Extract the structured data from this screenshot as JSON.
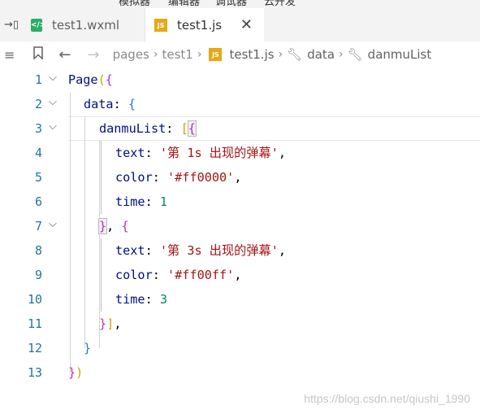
{
  "menubar": {
    "items": [
      "模拟器",
      "编辑器",
      "调试器",
      "云开发"
    ]
  },
  "tabs": [
    {
      "label": "test1.wxml",
      "icon": "wxml-file-icon",
      "active": false
    },
    {
      "label": "test1.js",
      "icon": "js-file-icon",
      "active": true
    }
  ],
  "breadcrumb": {
    "items": [
      "pages",
      "test1",
      "test1.js",
      "data",
      "danmuList"
    ]
  },
  "editor": {
    "lines": [
      {
        "n": "1"
      },
      {
        "n": "2"
      },
      {
        "n": "3"
      },
      {
        "n": "4"
      },
      {
        "n": "5"
      },
      {
        "n": "6"
      },
      {
        "n": "7"
      },
      {
        "n": "8"
      },
      {
        "n": "9"
      },
      {
        "n": "10"
      },
      {
        "n": "11"
      },
      {
        "n": "12"
      },
      {
        "n": "13"
      }
    ],
    "tokens": {
      "page": "Page",
      "data": "data",
      "danmuList": "danmuList",
      "text": "text",
      "color": "color",
      "time": "time",
      "text1": "'第 1s 出现的弹幕'",
      "color1": "'#ff0000'",
      "time1": "1",
      "text2": "'第 3s 出现的弹幕'",
      "color2": "'#ff00ff'",
      "time2": "3"
    }
  },
  "watermark": "https://blog.csdn.net/qiushi_1990",
  "colors": {
    "line_number": "#237893",
    "string": "#a31515",
    "number": "#098658",
    "keyword": "#0070c1",
    "identifier": "#001080"
  }
}
